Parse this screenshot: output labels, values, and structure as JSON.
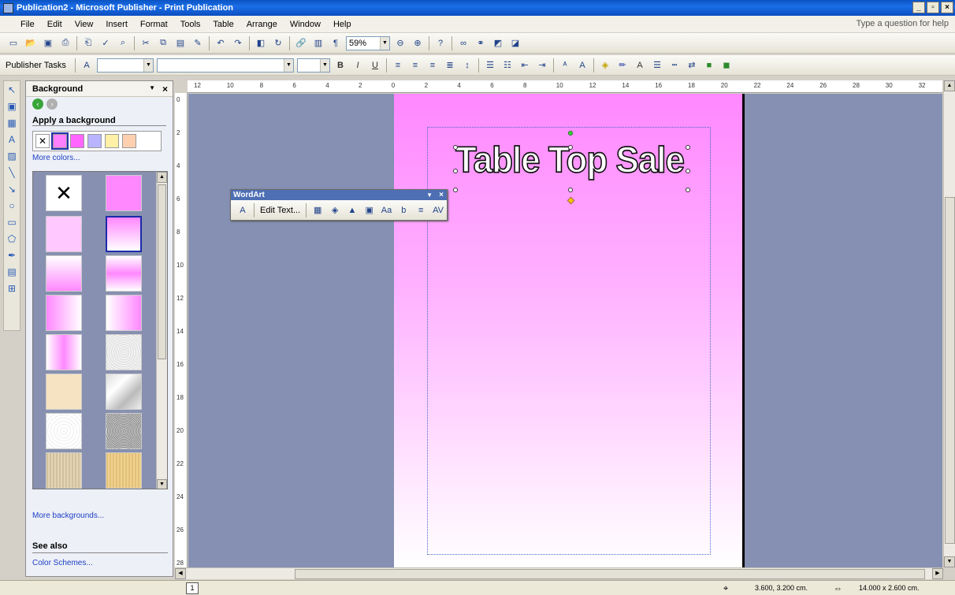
{
  "window": {
    "title": "Publication2 - Microsoft Publisher - Print Publication",
    "min": "_",
    "max": "▫",
    "close": "×"
  },
  "menu": {
    "items": [
      "File",
      "Edit",
      "View",
      "Insert",
      "Format",
      "Tools",
      "Table",
      "Arrange",
      "Window",
      "Help"
    ],
    "ask_placeholder": "Type a question for help"
  },
  "toolbar": {
    "zoom": "59%",
    "publisher_tasks": "Publisher Tasks"
  },
  "taskpane": {
    "title": "Background",
    "section_apply": "Apply a background",
    "more_colors": "More colors...",
    "more_backgrounds": "More backgrounds...",
    "see_also": "See also",
    "color_schemes": "Color Schemes...",
    "swatch_colors": [
      "#ff80ff",
      "#ff66ff",
      "#b8b4ff",
      "#fff0a8",
      "#ffd0b0"
    ]
  },
  "wordart_toolbar": {
    "title": "WordArt",
    "edit_text": "Edit Text..."
  },
  "wordart": {
    "text": "Table Top Sale"
  },
  "ruler": {
    "h_labels": [
      "12",
      "10",
      "8",
      "6",
      "4",
      "2",
      "0",
      "2",
      "4",
      "6",
      "8",
      "10",
      "12",
      "14",
      "16",
      "18",
      "20",
      "22",
      "24",
      "26",
      "28",
      "30",
      "32"
    ],
    "v_labels": [
      "0",
      "2",
      "4",
      "6",
      "8",
      "10",
      "12",
      "14",
      "16",
      "18",
      "20",
      "22",
      "24",
      "26",
      "28"
    ]
  },
  "status": {
    "page": "1",
    "position": "3.600, 3.200 cm.",
    "size": "14.000 x 2.600 cm."
  }
}
